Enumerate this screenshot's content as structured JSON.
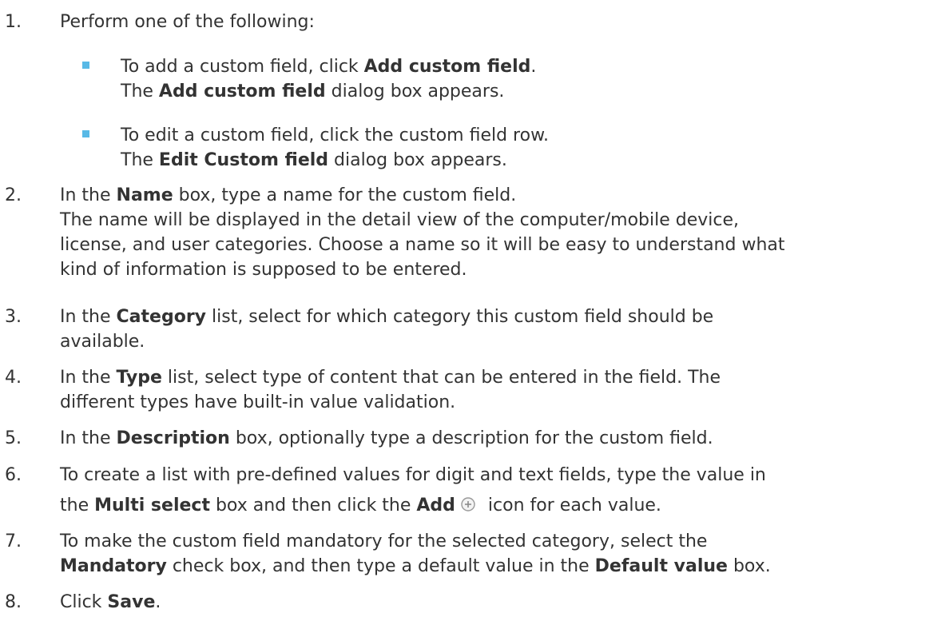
{
  "steps": [
    {
      "number": "1.",
      "text": "Perform one of the following:",
      "options": [
        {
          "line1": {
            "pre": "To add a custom field, click ",
            "bold": "Add custom field",
            "post": "."
          },
          "line2": {
            "pre": "The ",
            "bold": "Add custom field",
            "post": " dialog box appears."
          }
        },
        {
          "line1": {
            "pre": "To edit a custom field, click the custom field row."
          },
          "line2": {
            "pre": "The ",
            "bold": "Edit Custom field",
            "post": " dialog box appears."
          }
        }
      ]
    },
    {
      "number": "2.",
      "line1": {
        "pre": "In the ",
        "bold": "Name",
        "post": " box, type a name for the custom field."
      },
      "line2": "The name will be displayed in the detail view of the computer/mobile device,",
      "line3": "license, and user categories. Choose a name so it will be easy to understand what",
      "line4": "kind of information is supposed to be entered."
    },
    {
      "number": "3.",
      "line1": {
        "pre": "In the ",
        "bold": "Category",
        "post": " list, select for which category this custom field should be"
      },
      "line2": "available."
    },
    {
      "number": "4.",
      "line1": {
        "pre": "In the ",
        "bold": "Type",
        "post": " list, select type of content that can be entered in the field. The"
      },
      "line2": "different types have built-in value validation."
    },
    {
      "number": "5.",
      "line1": {
        "pre": "In the ",
        "bold": "Description",
        "post": " box, optionally type a description for the custom field."
      }
    },
    {
      "number": "6.",
      "line1": "To create a list with pre-defined values for digit and text fields, type the value in",
      "line2": {
        "pre": "the ",
        "bold": "Multi select",
        "mid": " box and then click the ",
        "bold2": "Add",
        "post": " icon for each value."
      },
      "icon": "add-circle-icon"
    },
    {
      "number": "7.",
      "line1": "To make the custom field mandatory for the selected category, select the",
      "line2": {
        "bold": "Mandatory",
        "mid": " check box, and then type a default value in the ",
        "bold2": "Default value",
        "post": " box."
      }
    },
    {
      "number": "8.",
      "line1": {
        "pre": "Click ",
        "bold": "Save",
        "post": "."
      }
    }
  ],
  "colors": {
    "text": "#333333",
    "bullet": "#58b9e6"
  }
}
